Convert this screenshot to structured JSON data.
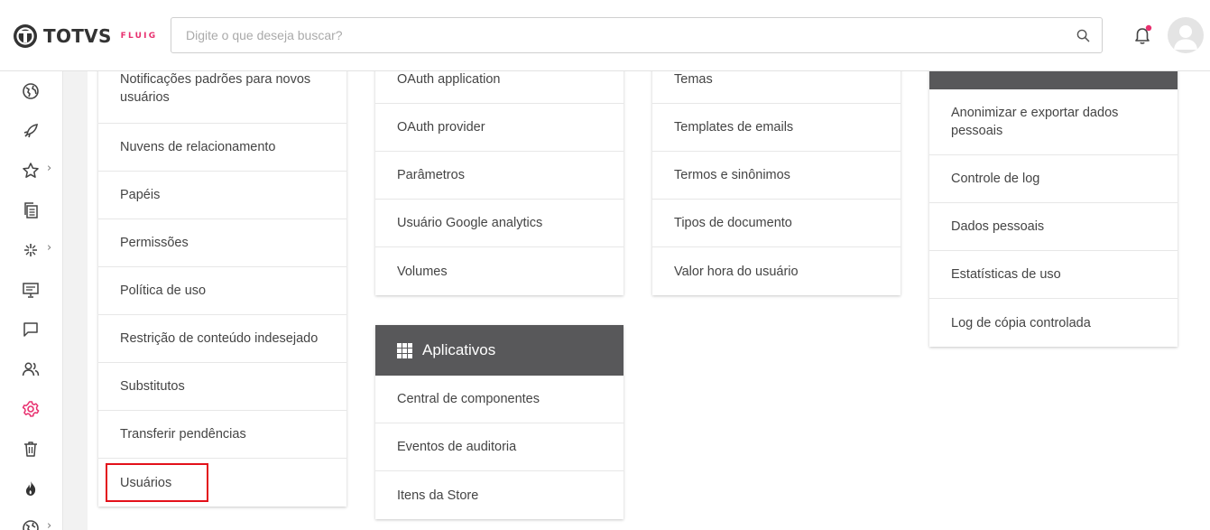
{
  "header": {
    "logo_text": "TOTVS",
    "logo_sub": "FLUIG",
    "search_placeholder": "Digite o que deseja buscar?"
  },
  "sidebar": {
    "items": [
      {
        "icon": "globe-icon"
      },
      {
        "icon": "rocket-icon"
      },
      {
        "icon": "star-icon",
        "has_submenu": true
      },
      {
        "icon": "documents-icon"
      },
      {
        "icon": "workflow-icon",
        "has_submenu": true
      },
      {
        "icon": "presentation-icon"
      },
      {
        "icon": "chat-icon"
      },
      {
        "icon": "users-icon"
      },
      {
        "icon": "gear-icon",
        "active": true
      },
      {
        "icon": "trash-icon"
      },
      {
        "icon": "flame-icon"
      },
      {
        "icon": "globe-icon",
        "has_submenu": true
      }
    ],
    "chevron": "›"
  },
  "columns": {
    "col1": {
      "items": [
        "Notificações padrões para novos usuários",
        "Nuvens de relacionamento",
        "Papéis",
        "Permissões",
        "Política de uso",
        "Restrição de conteúdo indesejado",
        "Substitutos",
        "Transferir pendências",
        "Usuários"
      ]
    },
    "col2": {
      "items": [
        "OAuth application",
        "OAuth provider",
        "Parâmetros",
        "Usuário Google analytics",
        "Volumes"
      ]
    },
    "apps": {
      "title": "Aplicativos",
      "items": [
        "Central de componentes",
        "Eventos de auditoria",
        "Itens da Store"
      ]
    },
    "col3": {
      "items": [
        "Temas",
        "Templates de emails",
        "Termos e sinônimos",
        "Tipos de documento",
        "Valor hora do usuário"
      ]
    },
    "col4": {
      "items": [
        "Anonimizar e exportar dados pessoais",
        "Controle de log",
        "Dados pessoais",
        "Estatísticas de uso",
        "Log de cópia controlada"
      ]
    }
  },
  "colors": {
    "accent": "#e8306f",
    "card_header": "#58585a",
    "highlight": "#e3101a"
  }
}
